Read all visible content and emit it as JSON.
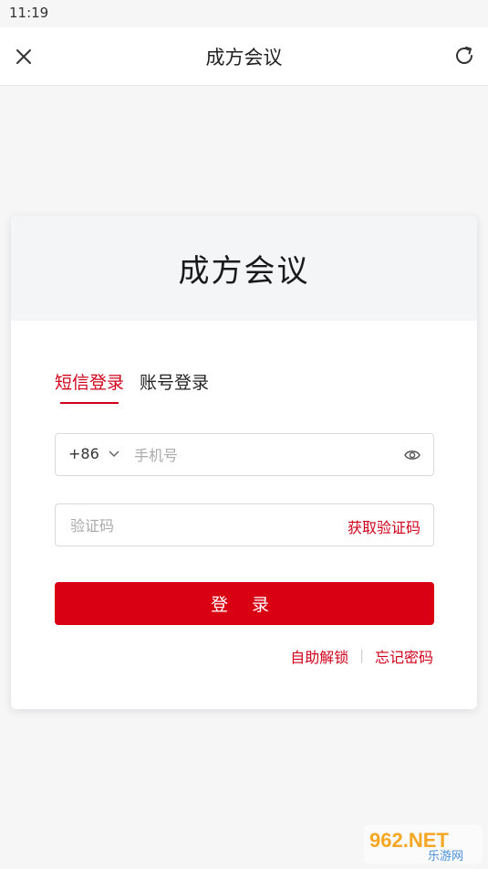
{
  "status": {
    "time": "11:19"
  },
  "nav": {
    "title": "成方会议",
    "close_icon": "close-icon",
    "refresh_icon": "refresh-icon"
  },
  "card": {
    "title": "成方会议"
  },
  "tabs": [
    {
      "label": "短信登录",
      "active": true
    },
    {
      "label": "账号登录",
      "active": false
    }
  ],
  "phone": {
    "country_code": "+86",
    "placeholder": "手机号"
  },
  "code": {
    "placeholder": "验证码",
    "get_code_label": "获取验证码"
  },
  "login_button": "登 录",
  "links": {
    "unlock": "自助解锁",
    "separator": "|",
    "forgot": "忘记密码"
  },
  "watermark": {
    "brand": "962.NET",
    "sub": "乐游网"
  },
  "colors": {
    "accent": "#d90013",
    "background": "#f6f6f7"
  }
}
